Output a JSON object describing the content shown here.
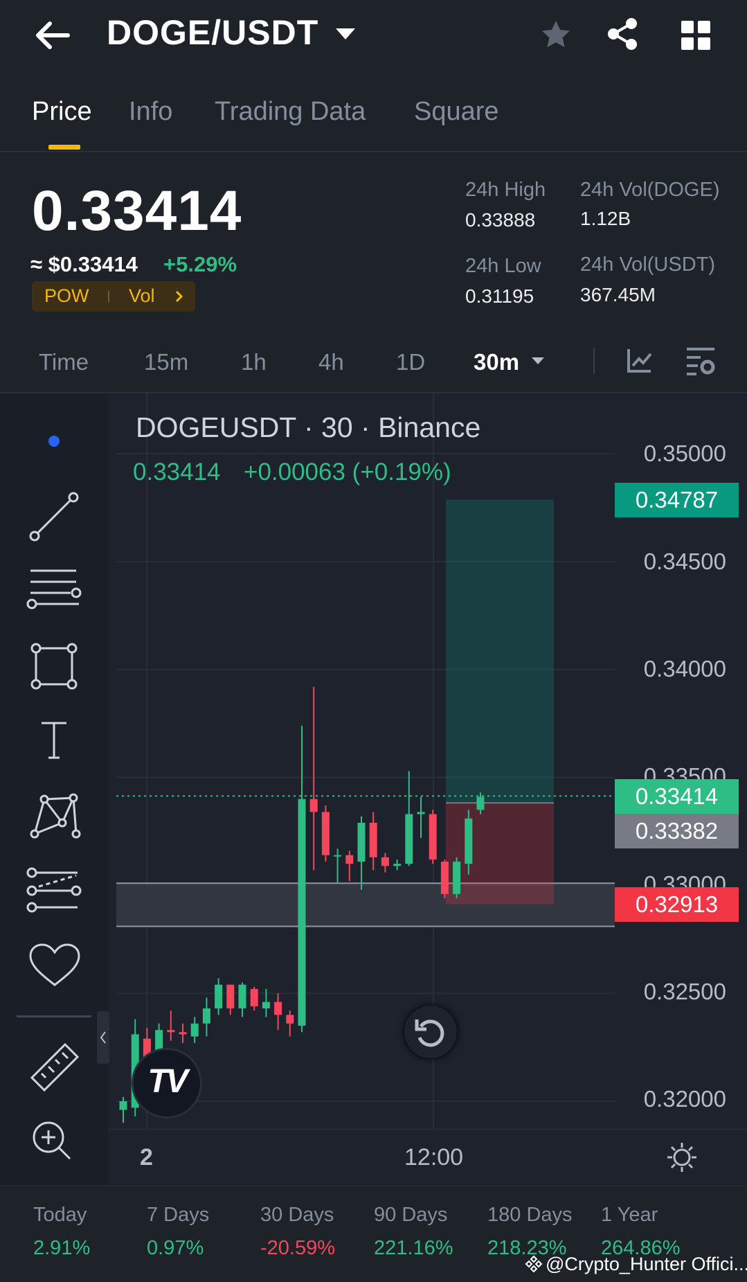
{
  "header": {
    "pair": "DOGE/USDT"
  },
  "tabs": [
    "Price",
    "Info",
    "Trading Data",
    "Square"
  ],
  "price": {
    "last": "0.33414",
    "usd": "≈ $0.33414",
    "change": "+5.29%",
    "tags": [
      "POW",
      "Vol"
    ]
  },
  "stats": {
    "high_label": "24h High",
    "high": "0.33888",
    "low_label": "24h Low",
    "low": "0.31195",
    "vol_doge_label": "24h Vol(DOGE)",
    "vol_doge": "1.12B",
    "vol_usdt_label": "24h Vol(USDT)",
    "vol_usdt": "367.45M"
  },
  "timeframes": {
    "items": [
      "Time",
      "15m",
      "1h",
      "4h",
      "1D"
    ],
    "selected": "30m"
  },
  "chart": {
    "title": "DOGEUSDT · 30 · Binance",
    "quote": "0.33414",
    "delta": "+0.00063 (+0.19%)",
    "x_labels": [
      "2",
      "12:00"
    ],
    "badges": {
      "target": "0.34787",
      "current": "0.33414",
      "entry": "0.33382",
      "stop": "0.32913"
    }
  },
  "chart_data": {
    "type": "candlestick",
    "y_ticks": [
      "0.35000",
      "0.34500",
      "0.34000",
      "0.33500",
      "0.33000",
      "0.32500",
      "0.32000"
    ],
    "ylim": [
      0.3185,
      0.3515
    ],
    "candles": [
      {
        "o": 0.3196,
        "c": 0.32,
        "h": 0.3202,
        "l": 0.319
      },
      {
        "o": 0.3197,
        "c": 0.3231,
        "h": 0.3238,
        "l": 0.3193
      },
      {
        "o": 0.3229,
        "c": 0.321,
        "h": 0.3234,
        "l": 0.3204
      },
      {
        "o": 0.321,
        "c": 0.3233,
        "h": 0.3236,
        "l": 0.3205
      },
      {
        "o": 0.3233,
        "c": 0.3232,
        "h": 0.3242,
        "l": 0.3228
      },
      {
        "o": 0.3232,
        "c": 0.3231,
        "h": 0.3236,
        "l": 0.3227
      },
      {
        "o": 0.323,
        "c": 0.3236,
        "h": 0.3239,
        "l": 0.3227
      },
      {
        "o": 0.3236,
        "c": 0.3243,
        "h": 0.3248,
        "l": 0.323
      },
      {
        "o": 0.3243,
        "c": 0.3254,
        "h": 0.3257,
        "l": 0.324
      },
      {
        "o": 0.3254,
        "c": 0.3243,
        "h": 0.3254,
        "l": 0.324
      },
      {
        "o": 0.3243,
        "c": 0.3254,
        "h": 0.3255,
        "l": 0.3239
      },
      {
        "o": 0.3252,
        "c": 0.3244,
        "h": 0.3253,
        "l": 0.3242
      },
      {
        "o": 0.3243,
        "c": 0.3246,
        "h": 0.3252,
        "l": 0.3239
      },
      {
        "o": 0.3246,
        "c": 0.324,
        "h": 0.325,
        "l": 0.3233
      },
      {
        "o": 0.324,
        "c": 0.3236,
        "h": 0.3242,
        "l": 0.323
      },
      {
        "o": 0.3235,
        "c": 0.334,
        "h": 0.3374,
        "l": 0.3232
      },
      {
        "o": 0.334,
        "c": 0.3334,
        "h": 0.3392,
        "l": 0.3307
      },
      {
        "o": 0.3334,
        "c": 0.3314,
        "h": 0.3337,
        "l": 0.3311
      },
      {
        "o": 0.3314,
        "c": 0.3314,
        "h": 0.3317,
        "l": 0.3301
      },
      {
        "o": 0.3314,
        "c": 0.331,
        "h": 0.3316,
        "l": 0.3302
      },
      {
        "o": 0.3311,
        "c": 0.3329,
        "h": 0.3332,
        "l": 0.3298
      },
      {
        "o": 0.3329,
        "c": 0.3313,
        "h": 0.3334,
        "l": 0.3307
      },
      {
        "o": 0.3313,
        "c": 0.3309,
        "h": 0.3315,
        "l": 0.3306
      },
      {
        "o": 0.3309,
        "c": 0.331,
        "h": 0.3312,
        "l": 0.3307
      },
      {
        "o": 0.331,
        "c": 0.3333,
        "h": 0.3353,
        "l": 0.3309
      },
      {
        "o": 0.3333,
        "c": 0.3334,
        "h": 0.3341,
        "l": 0.3322
      },
      {
        "o": 0.3333,
        "c": 0.3312,
        "h": 0.3335,
        "l": 0.331
      },
      {
        "o": 0.3311,
        "c": 0.3296,
        "h": 0.3312,
        "l": 0.3294
      },
      {
        "o": 0.3296,
        "c": 0.3311,
        "h": 0.3313,
        "l": 0.3294
      },
      {
        "o": 0.331,
        "c": 0.3331,
        "h": 0.3335,
        "l": 0.3305
      },
      {
        "o": 0.3335,
        "c": 0.3341,
        "h": 0.3343,
        "l": 0.3333
      }
    ],
    "current_price": 0.33414,
    "position": {
      "target": 0.34787,
      "entry": 0.33382,
      "stop": 0.32913
    },
    "zone": [
      0.3281,
      0.3301
    ]
  },
  "footer_brand": "TV",
  "performance": [
    {
      "label": "Today",
      "value": "2.91%",
      "color": "#2ebd85"
    },
    {
      "label": "7 Days",
      "value": "0.97%",
      "color": "#2ebd85"
    },
    {
      "label": "30 Days",
      "value": "-20.59%",
      "color": "#f6465d"
    },
    {
      "label": "90 Days",
      "value": "221.16%",
      "color": "#2ebd85"
    },
    {
      "label": "180 Days",
      "value": "218.23%",
      "color": "#2ebd85"
    },
    {
      "label": "1 Year",
      "value": "264.86%",
      "color": "#2ebd85"
    }
  ],
  "watermark": "@Crypto_Hunter Offici..."
}
